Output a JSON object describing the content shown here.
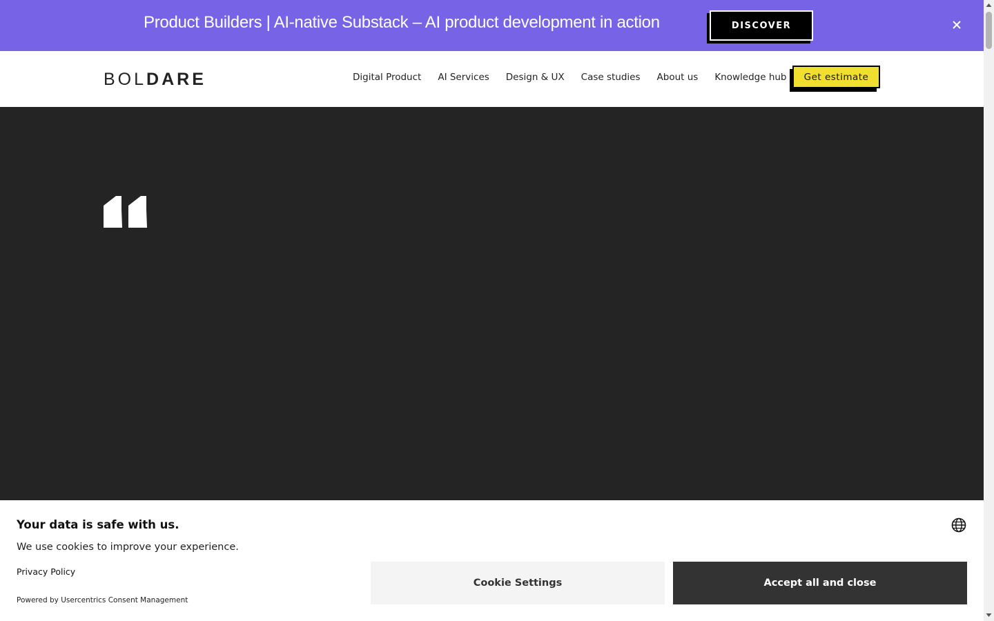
{
  "promo": {
    "text": "Product Builders | AI-native Substack – AI product development in action",
    "cta_label": "DISCOVER",
    "close_icon": "close-icon"
  },
  "header": {
    "logo_light": "BOL",
    "logo_bold": "DARE",
    "nav": [
      {
        "label": "Digital Product"
      },
      {
        "label": "AI Services"
      },
      {
        "label": "Design & UX"
      },
      {
        "label": "Case studies"
      },
      {
        "label": "About us"
      },
      {
        "label": "Knowledge hub"
      }
    ],
    "cta_label": "Get estimate"
  },
  "hero": {
    "icon": "quote-icon"
  },
  "cookie": {
    "title": "Your data is safe with us.",
    "description": "We use cookies to improve your experience.",
    "privacy_link": "Privacy Policy",
    "powered_prefix": "Powered by ",
    "powered_link": "Usercentrics Consent Management",
    "settings_label": "Cookie Settings",
    "accept_label": "Accept all and close",
    "language_icon": "globe-icon"
  },
  "colors": {
    "promo_bg": "#7663e5",
    "hero_bg": "#242424",
    "estimate_bg": "#f1df2f",
    "accept_bg": "#333333"
  }
}
